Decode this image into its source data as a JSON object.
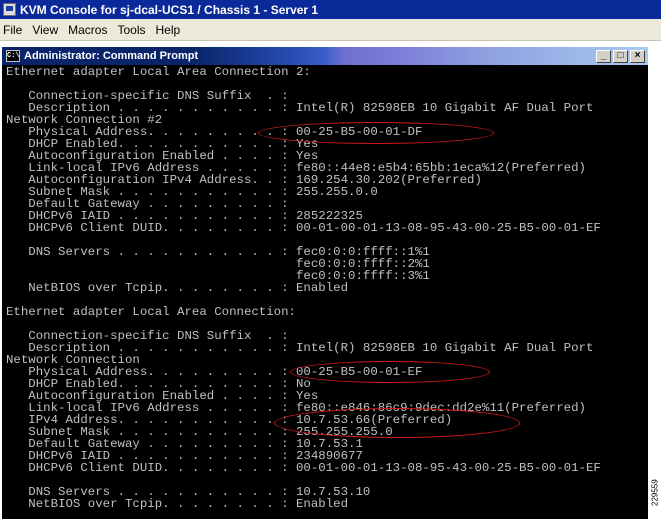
{
  "kvm_window": {
    "title": "KVM Console for sj-dcal-UCS1 / Chassis 1 - Server 1"
  },
  "menubar": {
    "items": [
      "File",
      "View",
      "Macros",
      "Tools",
      "Help"
    ]
  },
  "cmd_window": {
    "title": "Administrator: Command Prompt",
    "icon_label": "C:\\",
    "buttons": {
      "minimize": "_",
      "maximize": "□",
      "close": "×"
    }
  },
  "console": {
    "lines": [
      "Ethernet adapter Local Area Connection 2:",
      "",
      "   Connection-specific DNS Suffix  . :",
      "   Description . . . . . . . . . . . : Intel(R) 82598EB 10 Gigabit AF Dual Port",
      "Network Connection #2",
      "   Physical Address. . . . . . . . . : 00-25-B5-00-01-DF",
      "   DHCP Enabled. . . . . . . . . . . : Yes",
      "   Autoconfiguration Enabled . . . . : Yes",
      "   Link-local IPv6 Address . . . . . : fe80::44e8:e5b4:65bb:1eca%12(Preferred)",
      "   Autoconfiguration IPv4 Address. . : 169.254.30.202(Preferred)",
      "   Subnet Mask . . . . . . . . . . . : 255.255.0.0",
      "   Default Gateway . . . . . . . . . :",
      "   DHCPv6 IAID . . . . . . . . . . . : 285222325",
      "   DHCPv6 Client DUID. . . . . . . . : 00-01-00-01-13-08-95-43-00-25-B5-00-01-EF",
      "",
      "   DNS Servers . . . . . . . . . . . : fec0:0:0:ffff::1%1",
      "                                       fec0:0:0:ffff::2%1",
      "                                       fec0:0:0:ffff::3%1",
      "   NetBIOS over Tcpip. . . . . . . . : Enabled",
      "",
      "Ethernet adapter Local Area Connection:",
      "",
      "   Connection-specific DNS Suffix  . :",
      "   Description . . . . . . . . . . . : Intel(R) 82598EB 10 Gigabit AF Dual Port",
      "Network Connection",
      "   Physical Address. . . . . . . . . : 00-25-B5-00-01-EF",
      "   DHCP Enabled. . . . . . . . . . . : No",
      "   Autoconfiguration Enabled . . . . : Yes",
      "   Link-local IPv6 Address . . . . . : fe80::e846:86c9:9dec:dd2e%11(Preferred)",
      "   IPv4 Address. . . . . . . . . . . : 10.7.53.66(Preferred)",
      "   Subnet Mask . . . . . . . . . . . : 255.255.255.0",
      "   Default Gateway . . . . . . . . . : 10.7.53.1",
      "   DHCPv6 IAID . . . . . . . . . . . : 234890677",
      "   DHCPv6 Client DUID. . . . . . . . : 00-01-00-01-13-08-95-43-00-25-B5-00-01-EF",
      "",
      "   DNS Servers . . . . . . . . . . . : 10.7.53.10",
      "   NetBIOS over Tcpip. . . . . . . . : Enabled"
    ]
  },
  "figure_id": "229559",
  "colors": {
    "kvm_title_bg": "#0b2a9a",
    "menubar_bg": "#ece9d8",
    "console_bg": "#000000",
    "console_text": "#c0c0c0",
    "highlight_oval": "#d01818"
  }
}
